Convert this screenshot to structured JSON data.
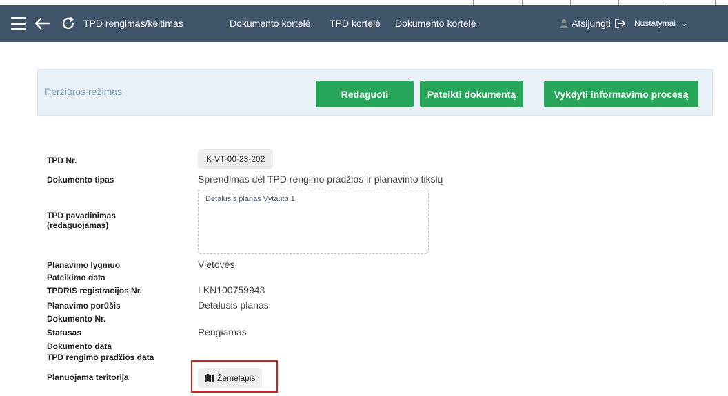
{
  "navbar": {
    "title": "TPD rengimas/keitimas",
    "links": [
      "Dokumento kortelė",
      "TPD kortelė",
      "Dokumento kortelė"
    ],
    "logout_label": "Atsijungti",
    "settings_label": "Nustatymai",
    "icons": [
      "hamburger-icon",
      "back-arrow-icon",
      "refresh-icon",
      "user-icon",
      "logout-icon",
      "chevron-down-icon"
    ]
  },
  "banner": {
    "mode_label": "Peržiūros režimas",
    "edit_button": "Redaguoti",
    "submit_button": "Pateikti dokumentą",
    "inform_button": "Vykdyti informavimo procesą",
    "button_color": "#27a65a",
    "background": "#e8f1f8"
  },
  "form": {
    "tpd_nr": {
      "label": "TPD Nr.",
      "value": "K-VT-00-23-202"
    },
    "doc_type": {
      "label": "Dokumento tipas",
      "value": "Sprendimas dėl TPD rengimo pradžios ir planavimo tikslų"
    },
    "tpd_name": {
      "label_line1": "TPD pavadinimas",
      "label_line2": "(redaguojamas)",
      "value": "Detalusis planas Vytauto 1"
    },
    "planning_level": {
      "label": "Planavimo lygmuo",
      "value": "Vietovės"
    },
    "submission_date": {
      "label": "Pateikimo data",
      "value": ""
    },
    "tpdris_reg": {
      "label": "TPDRIS registracijos Nr.",
      "value": "LKN100759943"
    },
    "planning_kind": {
      "label": "Planavimo porūšis",
      "value": "Detalusis planas"
    },
    "doc_nr": {
      "label": "Dokumento Nr.",
      "value": ""
    },
    "status": {
      "label": "Statusas",
      "value": "Rengiamas"
    },
    "doc_date": {
      "label": "Dokumento data",
      "value": ""
    },
    "start_date": {
      "label": "TPD rengimo pradžios data",
      "value": ""
    },
    "territory": {
      "label": "Planuojama teritorija",
      "map_button": "Žemėlapis",
      "map_icon": "map-icon"
    }
  },
  "highlight_color": "#d32121"
}
